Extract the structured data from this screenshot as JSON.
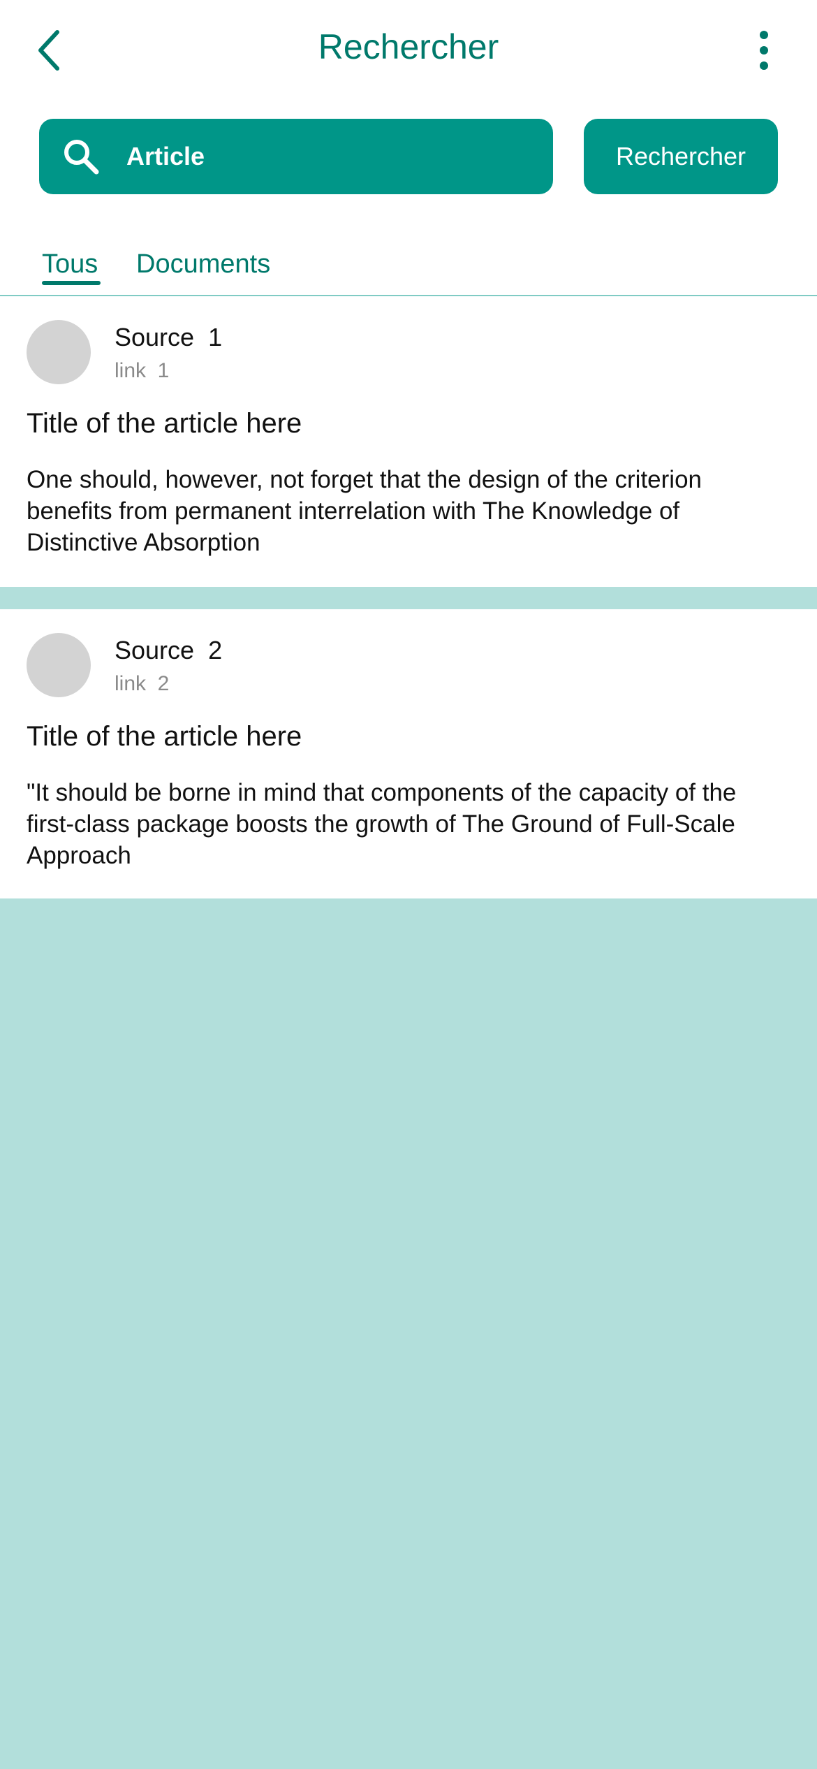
{
  "header": {
    "title": "Rechercher",
    "back_icon": "chevron-left-icon",
    "more_icon": "more-vertical-icon"
  },
  "search": {
    "value": "Article",
    "button_label": "Rechercher",
    "icon": "search-icon"
  },
  "tabs": [
    {
      "label": "Tous",
      "active": true
    },
    {
      "label": "Documents",
      "active": false
    }
  ],
  "results": [
    {
      "source": "Source  1",
      "link": "link  1",
      "title": "Title of the article here",
      "excerpt": "One should, however, not forget that the design of the criterion benefits from permanent interrelation with The Knowledge of Distinctive Absorption"
    },
    {
      "source": "Source  2",
      "link": "link  2",
      "title": "Title of the article here",
      "excerpt": "\"It should be borne in mind that components of the capacity of the first-class package boosts the growth of The Ground of Full-Scale Approach"
    }
  ],
  "colors": {
    "primary": "#009688",
    "primary_dark": "#00796b",
    "background": "#b2dfdb",
    "avatar": "#d3d3d3"
  }
}
